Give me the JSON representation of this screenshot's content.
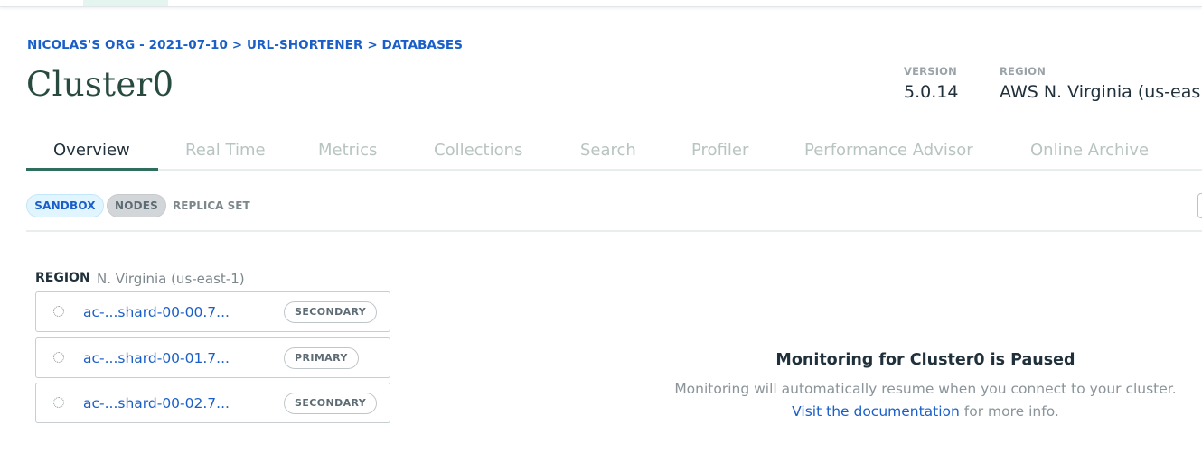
{
  "breadcrumb": {
    "org": "NICOLAS'S ORG - 2021-07-10",
    "sep1": ">",
    "project": "URL-SHORTENER",
    "sep2": ">",
    "section": "DATABASES"
  },
  "cluster": {
    "title": "Cluster0",
    "version_label": "VERSION",
    "version_value": "5.0.14",
    "region_label": "REGION",
    "region_value": "AWS N. Virginia (us-eas"
  },
  "tabs": [
    {
      "label": "Overview",
      "active": true
    },
    {
      "label": "Real Time"
    },
    {
      "label": "Metrics"
    },
    {
      "label": "Collections"
    },
    {
      "label": "Search"
    },
    {
      "label": "Profiler"
    },
    {
      "label": "Performance Advisor"
    },
    {
      "label": "Online Archive"
    }
  ],
  "badges": {
    "sandbox": "SANDBOX",
    "nodes": "NODES",
    "replica_set": "REPLICA SET"
  },
  "region": {
    "label": "REGION",
    "value": "N. Virginia (us-east-1)"
  },
  "nodes": [
    {
      "name": "ac-...shard-00-00.7...",
      "role": "SECONDARY"
    },
    {
      "name": "ac-...shard-00-01.7...",
      "role": "PRIMARY"
    },
    {
      "name": "ac-...shard-00-02.7...",
      "role": "SECONDARY"
    }
  ],
  "monitoring": {
    "title": "Monitoring for Cluster0 is Paused",
    "message": "Monitoring will automatically resume when you connect to your cluster.",
    "link_text": "Visit the documentation",
    "link_suffix": " for more info."
  },
  "colors": {
    "accent": "#1a5fc9",
    "title": "#284a3f",
    "tab_active_underline": "#2d6e5c"
  }
}
